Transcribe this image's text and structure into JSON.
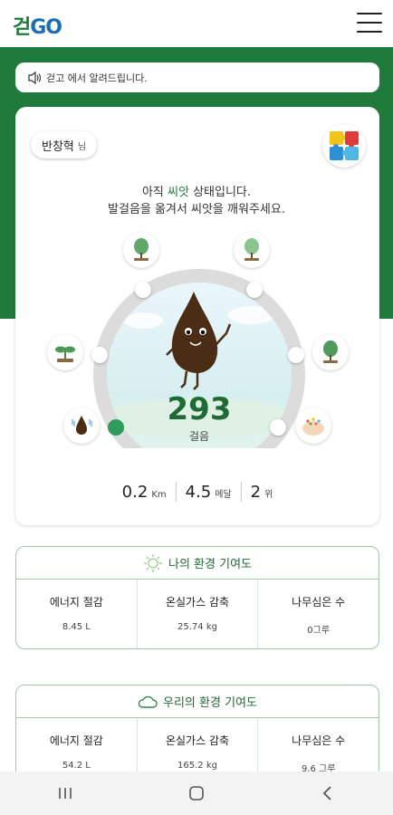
{
  "header": {
    "logo_ko": "걷",
    "logo_go": "GO"
  },
  "notice": {
    "text": "걷고 에서 알려드립니다."
  },
  "user": {
    "name": "반창혁",
    "suffix": "님"
  },
  "message": {
    "line1_pre": "아직 ",
    "line1_hl": "씨앗",
    "line1_post": " 상태입니다.",
    "line2": "발걸음을 옮겨서 씨앗을 깨워주세요."
  },
  "steps": {
    "count": "293",
    "unit": "걸음"
  },
  "stats": [
    {
      "value": "0.2",
      "unit": "Km"
    },
    {
      "value": "4.5",
      "unit": "메달"
    },
    {
      "value": "2",
      "unit": "위"
    }
  ],
  "my_contribution": {
    "title": "나의 환경 기여도",
    "items": [
      {
        "label": "에너지 절감",
        "value": "8.45 L"
      },
      {
        "label": "온실가스 감축",
        "value": "25.74 kg"
      },
      {
        "label": "나무심은 수",
        "value": "0그루"
      }
    ]
  },
  "our_contribution": {
    "title": "우리의 환경 기여도",
    "items": [
      {
        "label": "에너지 절감",
        "value": "54.2 L"
      },
      {
        "label": "온실가스 감축",
        "value": "165.2 kg"
      },
      {
        "label": "나무심은 수",
        "value": "9.6 그루"
      }
    ]
  },
  "colors": {
    "brand_green": "#1f7b3b",
    "accent_green": "#2e9b5b",
    "logo_blue": "#1b6fb0"
  },
  "icons": [
    "speaker-icon",
    "puzzle-icon",
    "tree-icon",
    "sprout-icon",
    "seed-icon",
    "sun-icon",
    "cloud-icon",
    "menu-icon",
    "recents-icon",
    "home-icon",
    "back-icon"
  ]
}
